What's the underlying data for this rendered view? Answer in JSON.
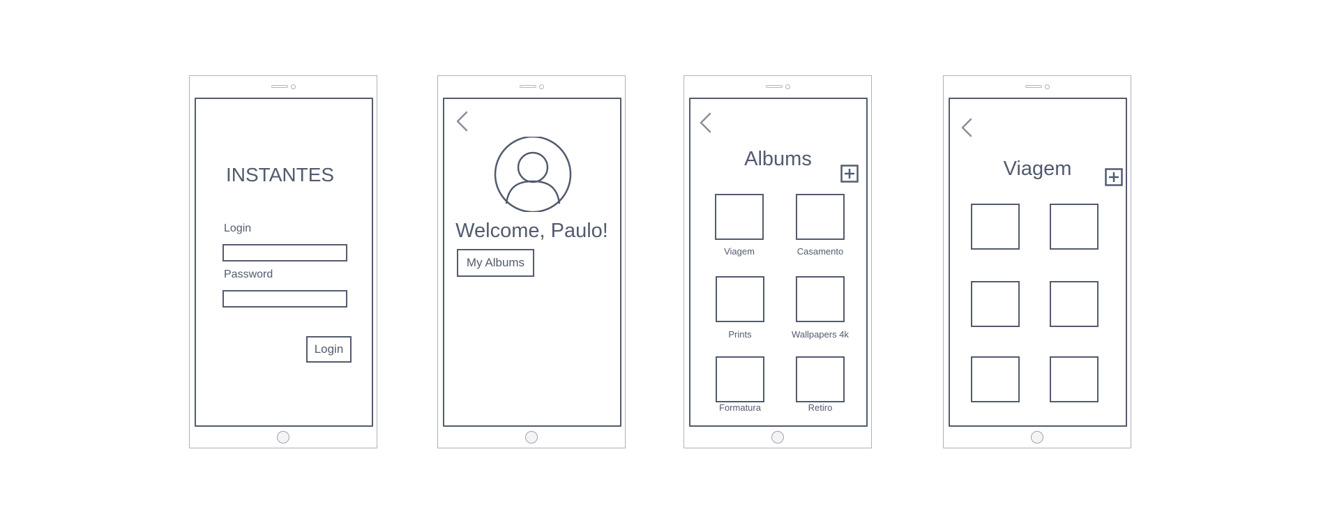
{
  "login_screen": {
    "app_title": "INSTANTES",
    "login_label": "Login",
    "login_value": "",
    "password_label": "Password",
    "password_value": "",
    "login_button": "Login"
  },
  "welcome_screen": {
    "avatar_icon": "user-avatar-icon",
    "greeting": "Welcome, Paulo!",
    "my_albums_button": "My Albums"
  },
  "albums_screen": {
    "title": "Albums",
    "add_icon": "plus-square-icon",
    "albums": [
      {
        "name": "Viagem"
      },
      {
        "name": "Casamento"
      },
      {
        "name": "Prints"
      },
      {
        "name": "Wallpapers 4k"
      },
      {
        "name": "Formatura"
      },
      {
        "name": "Retiro"
      }
    ]
  },
  "album_detail_screen": {
    "title": "Viagem",
    "add_icon": "plus-square-icon",
    "photo_count": 6
  },
  "colors": {
    "stroke": "#525a6e",
    "device_outline": "#aeb1bd",
    "icon_gray": "#8a8e9c"
  }
}
